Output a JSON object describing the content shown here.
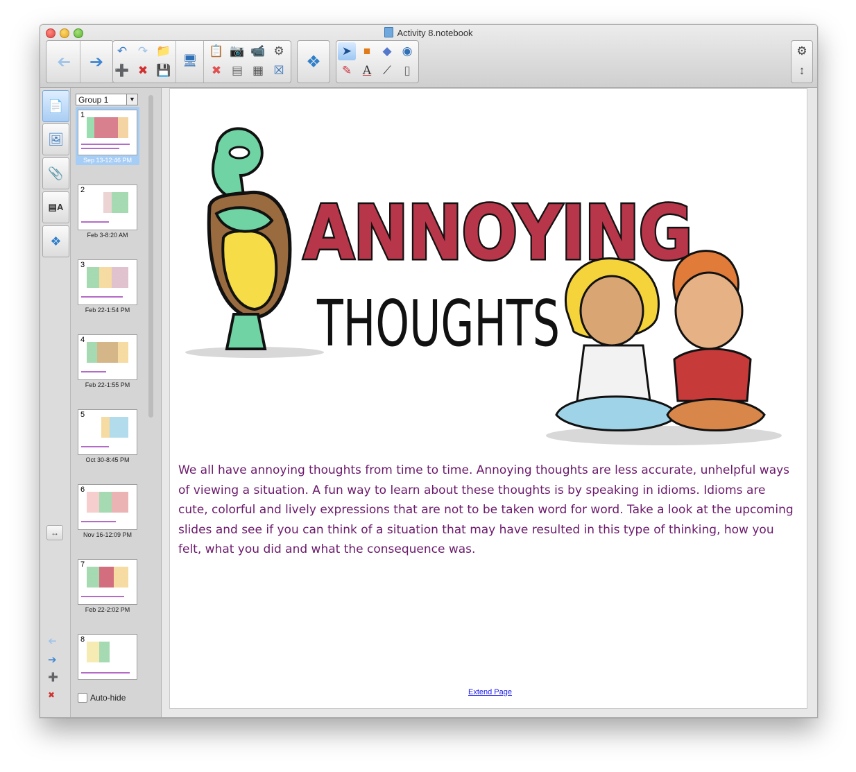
{
  "window": {
    "title": "Activity 8.notebook"
  },
  "toolbar": {
    "back_icon": "back-arrow-icon",
    "forward_icon": "forward-arrow-icon",
    "buttons": [
      "undo-icon",
      "redo-icon",
      "open-folder-icon",
      "add-page-icon",
      "delete-page-icon",
      "save-icon",
      "screen-shade-icon",
      "paste-icon",
      "screen-capture-icon",
      "document-camera-icon",
      "fill-icon",
      "delete-icon",
      "display-icon",
      "table-icon",
      "fit-icon",
      "addon-puzzle-icon",
      "select-icon",
      "shape-icon",
      "eraser-tool-icon",
      "fill-tool-icon",
      "pens-icon",
      "text-icon",
      "line-icon",
      "eraser-icon",
      "settings-gear-icon",
      "expand-icon"
    ]
  },
  "sorter": {
    "group_label": "Group 1",
    "autohide_label": "Auto-hide",
    "pages": [
      {
        "num": "1",
        "date": "Sep 13-12:46 PM"
      },
      {
        "num": "2",
        "date": "Feb 3-8:20 AM"
      },
      {
        "num": "3",
        "date": "Feb 22-1:54 PM"
      },
      {
        "num": "4",
        "date": "Feb 22-1:55 PM"
      },
      {
        "num": "5",
        "date": "Oct 30-8:45 PM"
      },
      {
        "num": "6",
        "date": "Nov 16-12:09 PM"
      },
      {
        "num": "7",
        "date": "Feb 22-2:02 PM"
      },
      {
        "num": "8",
        "date": ""
      }
    ]
  },
  "canvas": {
    "heading_word_1": "ANNOYING",
    "heading_word_2": "THOUGHTS",
    "paragraph": "We all have annoying thoughts from time to time.  Annoying thoughts are less accurate, unhelpful ways of viewing a situation.  A fun way to learn about these thoughts is by speaking in idioms.  Idioms are cute, colorful and lively expressions that are not to be taken word for word.  Take a look at the upcoming slides and see if you can think of a situation that may have resulted in this type of thinking, how you felt, what you did and what the consequence was.",
    "extend_link": "Extend Page"
  },
  "colors": {
    "text_purple": "#6b1a6b",
    "accent_blue": "#3f86d2",
    "heading_red": "#b8364a"
  }
}
